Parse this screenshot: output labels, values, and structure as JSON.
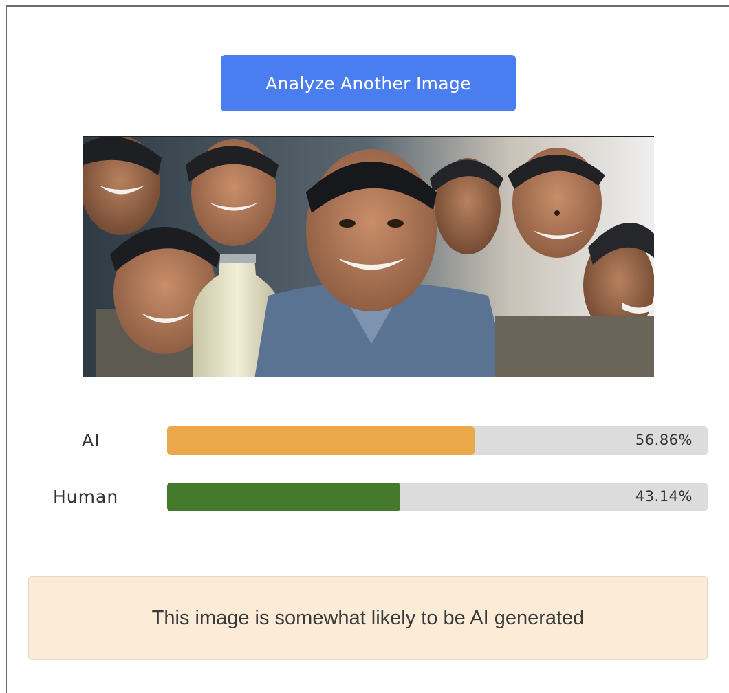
{
  "actions": {
    "analyze_another_label": "Analyze Another Image"
  },
  "image": {
    "description_icon": "photo"
  },
  "results": [
    {
      "label": "AI",
      "value_text": "56.86%",
      "percent": 56.86,
      "color": "#eba84b"
    },
    {
      "label": "Human",
      "value_text": "43.14%",
      "percent": 43.14,
      "color": "#457a2d"
    }
  ],
  "verdict": {
    "text": "This image is somewhat likely to be AI generated"
  },
  "colors": {
    "button": "#4a7ef0",
    "track": "#dcdcdc",
    "verdict_bg": "#fcebd7"
  }
}
